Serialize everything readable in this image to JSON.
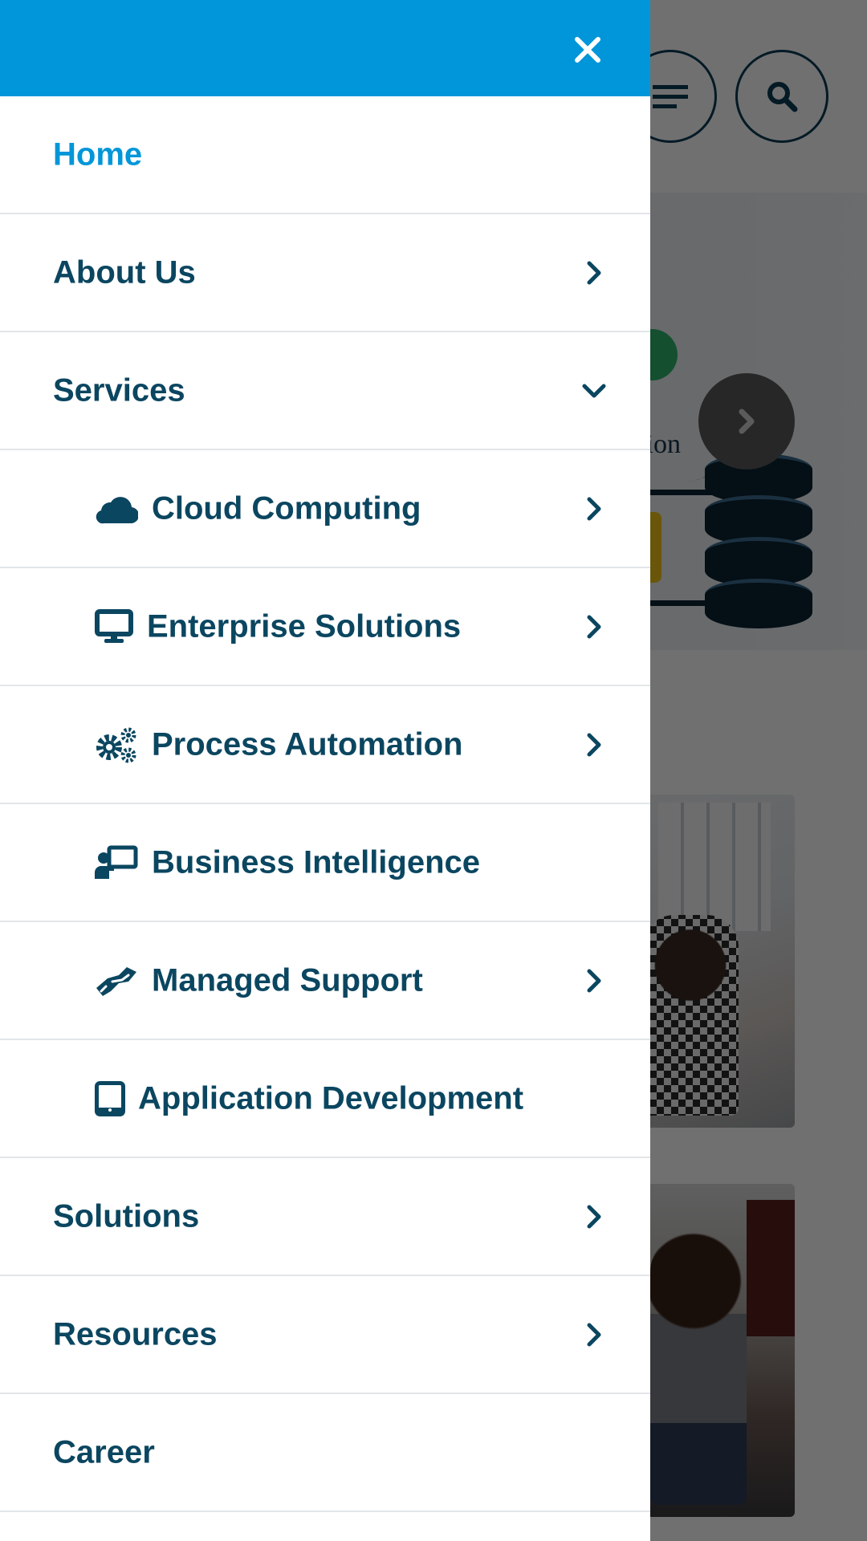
{
  "colors": {
    "header_blue": "#0096d9",
    "menu_text": "#0b4660",
    "active_text": "#0096d9",
    "divider": "#e2e6e9"
  },
  "drawer": {
    "close_icon": "close-icon",
    "items": [
      {
        "label": "Home",
        "active": true
      },
      {
        "label": "About Us",
        "chevron": "right"
      },
      {
        "label": "Services",
        "chevron": "down",
        "expanded": true
      },
      {
        "label": "Cloud Computing",
        "icon": "cloud-icon",
        "chevron": "right",
        "sub": true
      },
      {
        "label": "Enterprise Solutions",
        "icon": "desktop-icon",
        "chevron": "right",
        "sub": true
      },
      {
        "label": "Process Automation",
        "icon": "cogs-icon",
        "chevron": "right",
        "sub": true
      },
      {
        "label": "Business Intelligence",
        "icon": "chalkboard-teacher-icon",
        "sub": true
      },
      {
        "label": "Managed Support",
        "icon": "handshake-icon",
        "chevron": "right",
        "sub": true
      },
      {
        "label": "Application Development",
        "icon": "tablet-icon",
        "sub": true
      },
      {
        "label": "Solutions",
        "chevron": "right"
      },
      {
        "label": "Resources",
        "chevron": "right"
      },
      {
        "label": "Career"
      }
    ]
  },
  "background": {
    "hero_text": "ation",
    "header_icons": [
      "menu-icon",
      "search-icon"
    ]
  }
}
